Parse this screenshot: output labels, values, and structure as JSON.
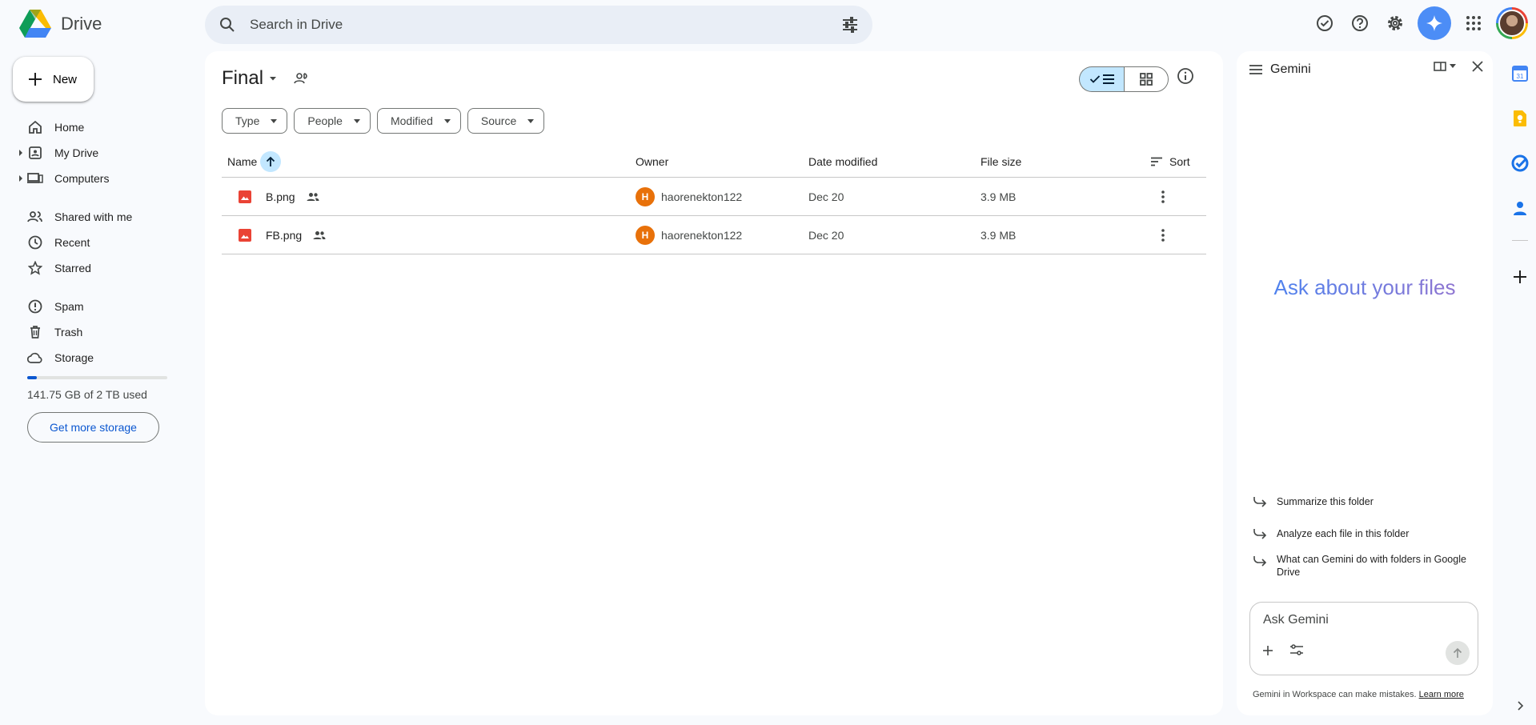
{
  "app": {
    "name": "Drive"
  },
  "search": {
    "placeholder": "Search in Drive"
  },
  "sidebar": {
    "new_label": "New",
    "items": [
      {
        "label": "Home",
        "icon": "home-icon"
      },
      {
        "label": "My Drive",
        "icon": "my-drive-icon"
      },
      {
        "label": "Computers",
        "icon": "computers-icon"
      },
      {
        "label": "Shared with me",
        "icon": "shared-icon"
      },
      {
        "label": "Recent",
        "icon": "clock-icon"
      },
      {
        "label": "Starred",
        "icon": "star-icon"
      },
      {
        "label": "Spam",
        "icon": "spam-icon"
      },
      {
        "label": "Trash",
        "icon": "trash-icon"
      },
      {
        "label": "Storage",
        "icon": "cloud-icon"
      }
    ],
    "storage_text": "141.75 GB of 2 TB used",
    "storage_fraction": 0.07,
    "more_storage_label": "Get more storage"
  },
  "main": {
    "title": "Final",
    "filters": [
      "Type",
      "People",
      "Modified",
      "Source"
    ],
    "columns": {
      "name": "Name",
      "owner": "Owner",
      "modified": "Date modified",
      "size": "File size",
      "sort": "Sort"
    },
    "files": [
      {
        "name": "B.png",
        "owner_initial": "H",
        "owner": "haorenekton122",
        "modified": "Dec 20",
        "size": "3.9 MB"
      },
      {
        "name": "FB.png",
        "owner_initial": "H",
        "owner": "haorenekton122",
        "modified": "Dec 20",
        "size": "3.9 MB"
      }
    ]
  },
  "gemini": {
    "title": "Gemini",
    "hero": "Ask about your files",
    "suggestions": [
      "Summarize this folder",
      "Analyze each file in this folder",
      "What can Gemini do with folders in Google Drive"
    ],
    "input_placeholder": "Ask Gemini",
    "footer_text": "Gemini in Workspace can make mistakes.",
    "footer_link": "Learn more"
  },
  "rail": {
    "calendar_day": "31"
  },
  "colors": {
    "accent": "#0b57d0",
    "selected": "#c2e7ff",
    "owner_avatar": "#e8710a",
    "image_file": "#ea4335"
  }
}
